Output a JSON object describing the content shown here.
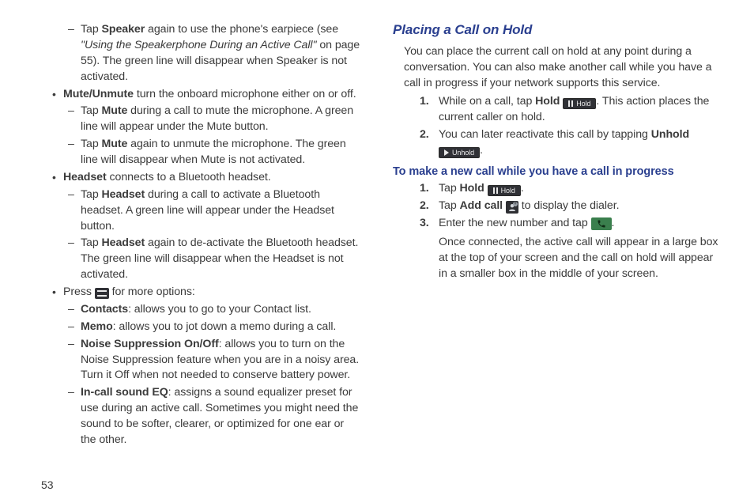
{
  "page_number": "53",
  "left": {
    "dash1_pre": "Tap ",
    "dash1_b": "Speaker",
    "cross_ref_text": "\"Using the Speakerphone During an Active Call\"",
    "dash1_post1": " again to use the phone's earpiece (see ",
    "dash1_post2": " on page 55). The green line will disappear when Speaker is not activated.",
    "bullet2_b": "Mute/Unmute",
    "bullet2_t": " turn the onboard microphone either on or off.",
    "dash2a_pre": "Tap ",
    "dash2a_b": "Mute",
    "dash2a_post": " during a call to mute the microphone. A green line will appear under the Mute button.",
    "dash2b_pre": "Tap ",
    "dash2b_b": "Mute",
    "dash2b_post": " again to unmute the microphone. The green line will disappear when Mute is not activated.",
    "bullet3_b": "Headset",
    "bullet3_t": " connects to a Bluetooth headset.",
    "dash3a_pre": "Tap ",
    "dash3a_b": "Headset",
    "dash3a_post": " during a call to activate a Bluetooth headset. A green line will appear under the Headset button.",
    "dash3b_pre": "Tap ",
    "dash3b_b": "Headset",
    "dash3b_post": " again to de-activate the Bluetooth headset. The green line will disappear when the Headset is not activated.",
    "bullet4_pre": "Press ",
    "bullet4_post": " for more options:",
    "dash4a_b": "Contacts",
    "dash4a_t": ": allows you to go to your Contact list.",
    "dash4b_b": "Memo",
    "dash4b_t": ": allows you to jot down a memo during a call.",
    "dash4c_b": "Noise Suppression On/Off",
    "dash4c_t": ": allows you to turn on the Noise Suppression feature when you are in a noisy area. Turn it Off when not needed to conserve battery power.",
    "dash4d_b": "In-call sound EQ",
    "dash4d_t": ": assigns a sound equalizer preset for use during an active call. Sometimes you might need the sound to be softer, clearer, or optimized for one ear or the other."
  },
  "right": {
    "h3": "Placing a Call on Hold",
    "para": "You can place the current call on hold at any point during a conversation. You can also make another call while you have a call in progress if your network supports this service.",
    "n1_pre": "While on a call, tap ",
    "n1_b": "Hold",
    "n1_sp": " ",
    "n1_post": ". This action places the current caller on hold.",
    "btn_hold": "Hold",
    "btn_unhold": "Unhold",
    "n2_pre": "You can later reactivate this call by tapping ",
    "n2_b": "Unhold",
    "n2_sp": " ",
    "n2_post": ".",
    "h4": "To make a new call while you have a call in progress",
    "s1_pre": "Tap ",
    "s1_b": "Hold",
    "s1_sp": " ",
    "s1_post": ".",
    "s2_pre": "Tap ",
    "s2_b": "Add call",
    "s2_sp": " ",
    "s2_post": " to display the dialer.",
    "s3_pre": "Enter the new number and tap ",
    "s3_post": ".",
    "s3_follow": "Once connected, the active call will appear in a large box at the top of your screen and the call on hold will appear in a smaller box in the middle of your screen."
  }
}
